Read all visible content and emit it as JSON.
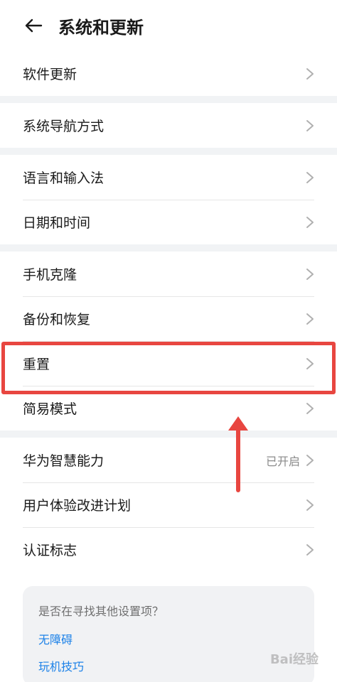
{
  "header": {
    "title": "系统和更新"
  },
  "groups": [
    {
      "items": [
        {
          "label": "软件更新"
        }
      ]
    },
    {
      "items": [
        {
          "label": "系统导航方式"
        }
      ]
    },
    {
      "items": [
        {
          "label": "语言和输入法"
        },
        {
          "label": "日期和时间"
        }
      ]
    },
    {
      "items": [
        {
          "label": "手机克隆"
        },
        {
          "label": "备份和恢复"
        },
        {
          "label": "重置"
        },
        {
          "label": "简易模式"
        }
      ]
    },
    {
      "items": [
        {
          "label": "华为智慧能力",
          "value": "已开启"
        },
        {
          "label": "用户体验改进计划"
        },
        {
          "label": "认证标志"
        }
      ]
    }
  ],
  "suggest": {
    "title": "是否在寻找其他设置项？",
    "links": [
      "无障碍",
      "玩机技巧"
    ]
  },
  "watermark": "Bai经验",
  "colors": {
    "highlight": "#e84640",
    "link": "#1d82e8",
    "background": "#f1f3f5"
  }
}
